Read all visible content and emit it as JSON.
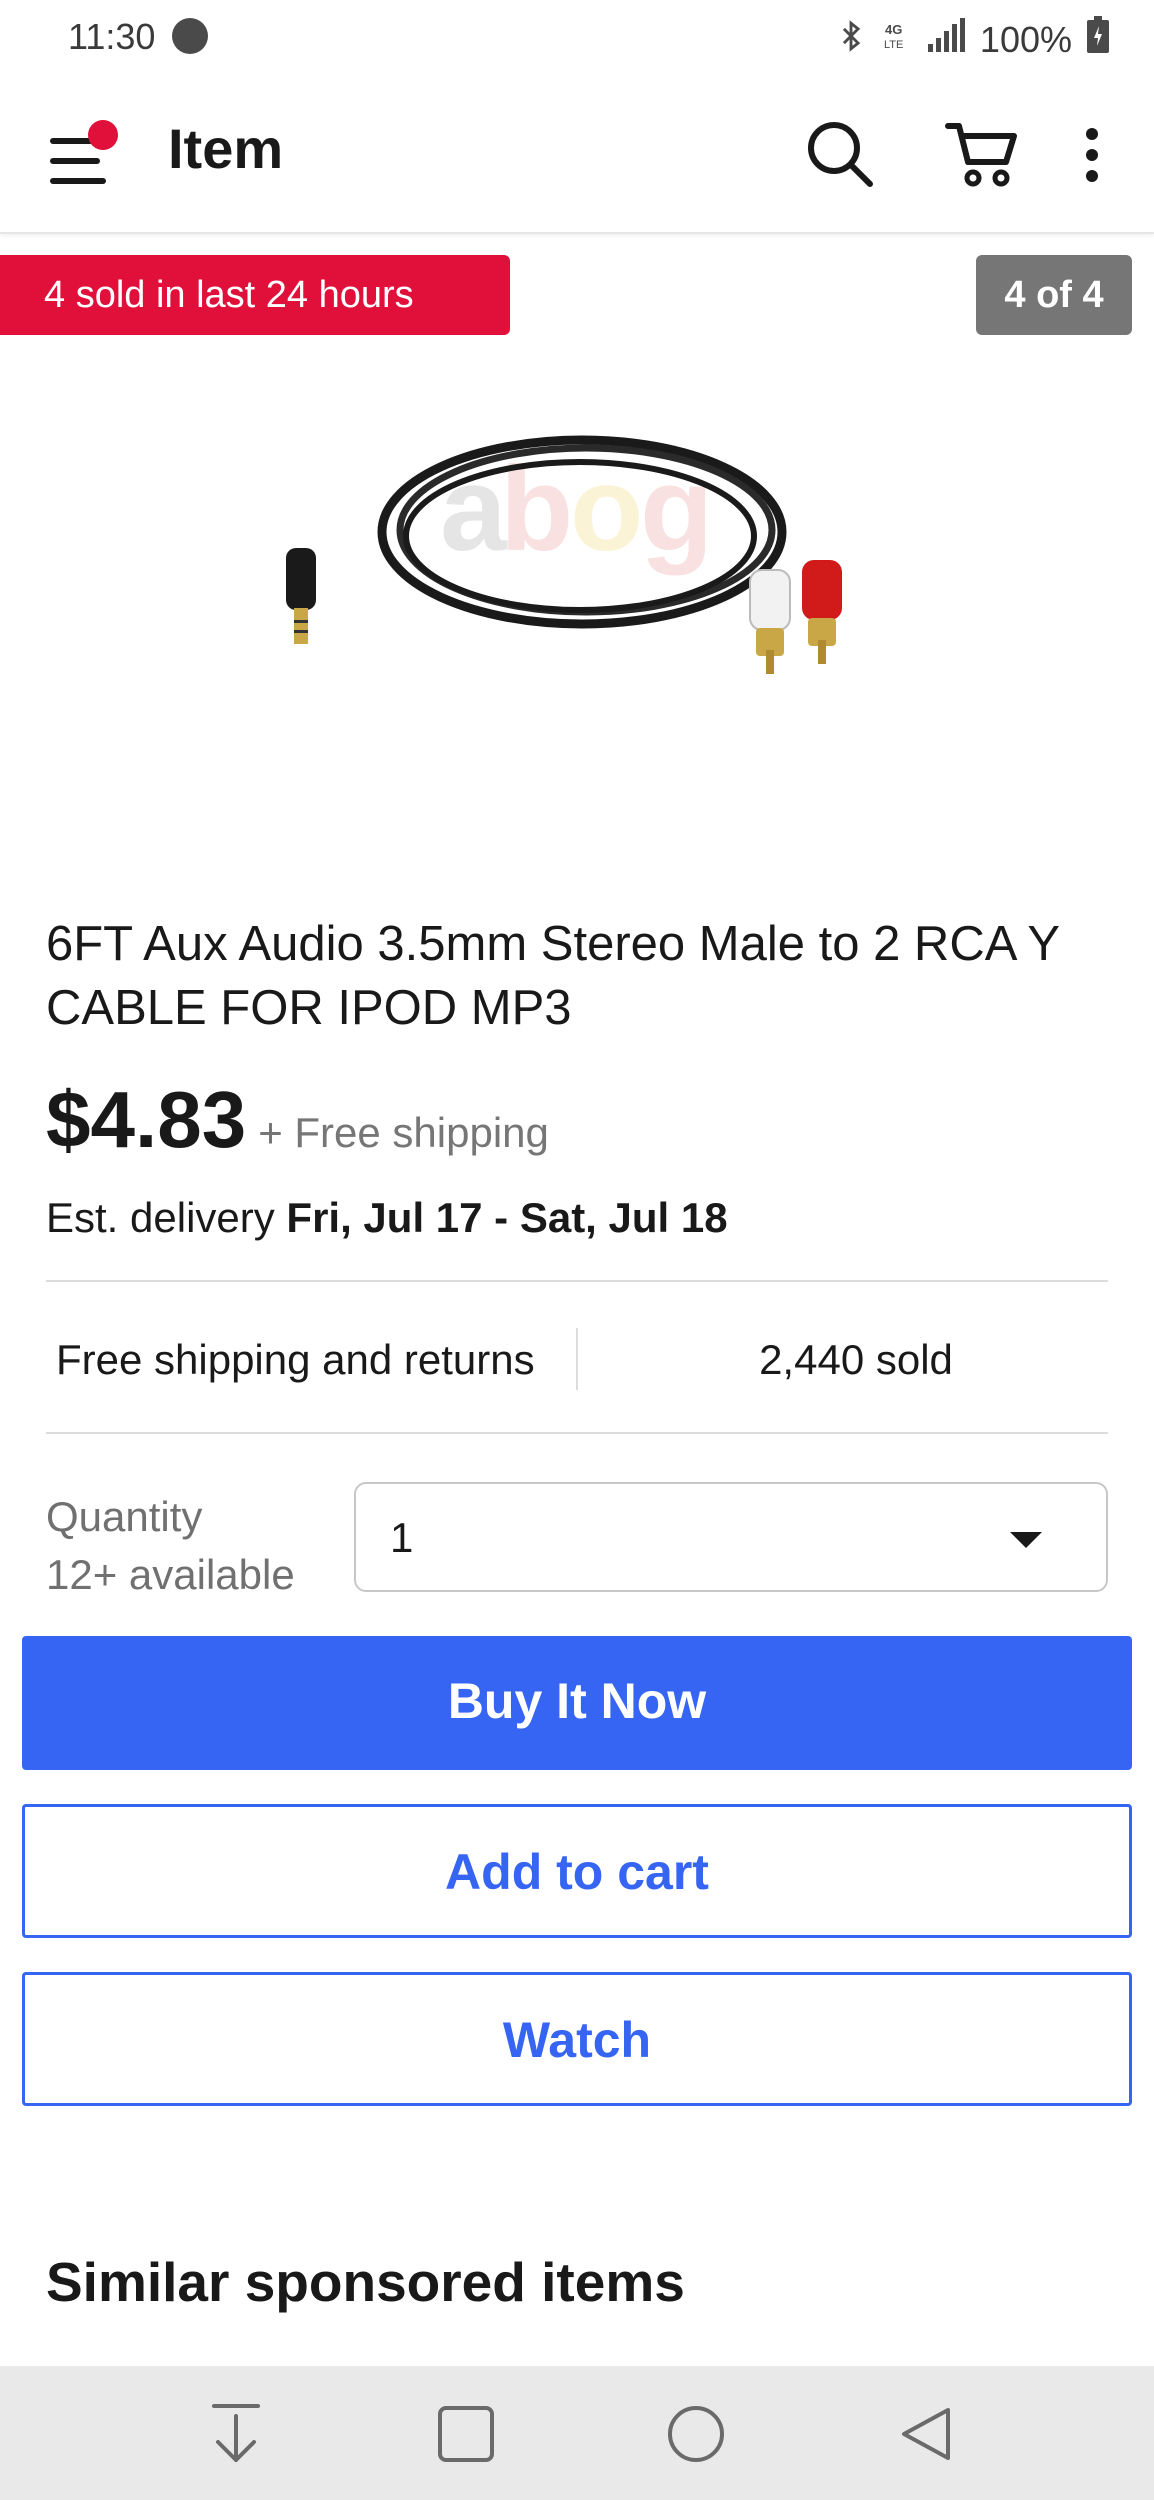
{
  "status_bar": {
    "time": "11:30",
    "network": "4G LTE",
    "battery": "100%",
    "icons": [
      "app-notification-icon",
      "bluetooth-icon",
      "network-4g-icon",
      "signal-icon",
      "battery-icon"
    ]
  },
  "app_bar": {
    "title": "Item",
    "icons": [
      "menu-icon",
      "search-icon",
      "cart-icon",
      "more-vertical-icon"
    ]
  },
  "hero": {
    "sold_badge": "4 sold in last 24 hours",
    "image_counter": "4 of 4",
    "image_icon": "aux-rca-cable-image"
  },
  "product": {
    "title": "6FT Aux Audio 3.5mm Stereo Male to 2 RCA Y CABLE FOR IPOD MP3",
    "price": "$4.83",
    "shipping_note": "+ Free shipping",
    "delivery_prefix": "Est. delivery ",
    "delivery_dates": "Fri, Jul 17 - Sat, Jul 18",
    "info_left": "Free shipping and returns",
    "info_right": "2,440 sold"
  },
  "quantity": {
    "label": "Quantity",
    "availability": "12+ available",
    "value": "1"
  },
  "actions": {
    "buy_now": "Buy It Now",
    "add_to_cart": "Add to cart",
    "watch": "Watch"
  },
  "similar": {
    "heading": "Similar sponsored items"
  },
  "colors": {
    "accent_blue": "#3665f3",
    "badge_red": "#e0103a",
    "counter_gray": "#767676"
  },
  "nav_bar": {
    "icons": [
      "download-icon",
      "recents-square-icon",
      "home-circle-icon",
      "back-triangle-icon"
    ]
  }
}
